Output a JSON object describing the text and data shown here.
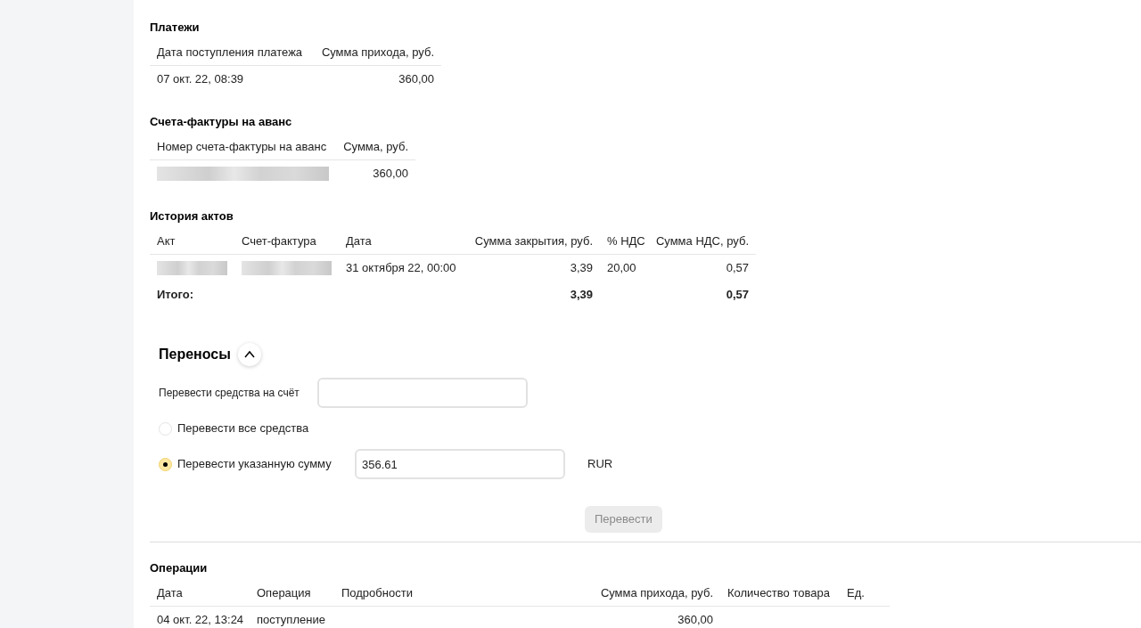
{
  "payments": {
    "title": "Платежи",
    "columns": [
      "Дата поступления платежа",
      "Сумма прихода, руб."
    ],
    "rows": [
      [
        {
          "kind": "text",
          "text": "07 окт. 22, 08:39"
        },
        {
          "kind": "text",
          "text": "360,00"
        }
      ]
    ]
  },
  "advance_invoices": {
    "title": "Счета-фактуры на аванс",
    "columns": [
      "Номер счета-фактуры на аванс",
      "Сумма, руб."
    ],
    "rows": [
      [
        {
          "kind": "redacted"
        },
        {
          "kind": "text",
          "text": "360,00"
        }
      ]
    ]
  },
  "acts": {
    "title": "История актов",
    "columns": [
      "Акт",
      "Счет-фактура",
      "Дата",
      "Сумма закрытия, руб.",
      "% НДС",
      "Сумма НДС, руб."
    ],
    "rows": [
      [
        {
          "kind": "redacted"
        },
        {
          "kind": "redacted"
        },
        {
          "kind": "text",
          "text": "31 октября 22, 00:00"
        },
        {
          "kind": "text",
          "text": "3,39"
        },
        {
          "kind": "text",
          "text": "20,00"
        },
        {
          "kind": "text",
          "text": "0,57"
        }
      ]
    ],
    "total": {
      "label": "Итого:",
      "closing_sum": "3,39",
      "vat_sum": "0,57"
    }
  },
  "transfers": {
    "title": "Переносы",
    "expanded": true,
    "account_label": "Перевести средства на счёт",
    "options": [
      {
        "label": "Перевести все средства",
        "selected": false
      },
      {
        "label": "Перевести указанную сумму",
        "selected": true,
        "value": "356.61",
        "currency": "RUR"
      }
    ],
    "button": {
      "label": "Перевести",
      "disabled": true
    }
  },
  "operations": {
    "title": "Операции",
    "columns": [
      "Дата",
      "Операция",
      "Подробности",
      "Сумма прихода, руб.",
      "Количество товара",
      "Ед."
    ],
    "rows": [
      [
        {
          "kind": "text",
          "text": "04 окт. 22, 13:24"
        },
        {
          "kind": "text",
          "text": "поступление"
        },
        "",
        {
          "kind": "text",
          "text": "360,00"
        },
        "",
        ""
      ]
    ]
  }
}
